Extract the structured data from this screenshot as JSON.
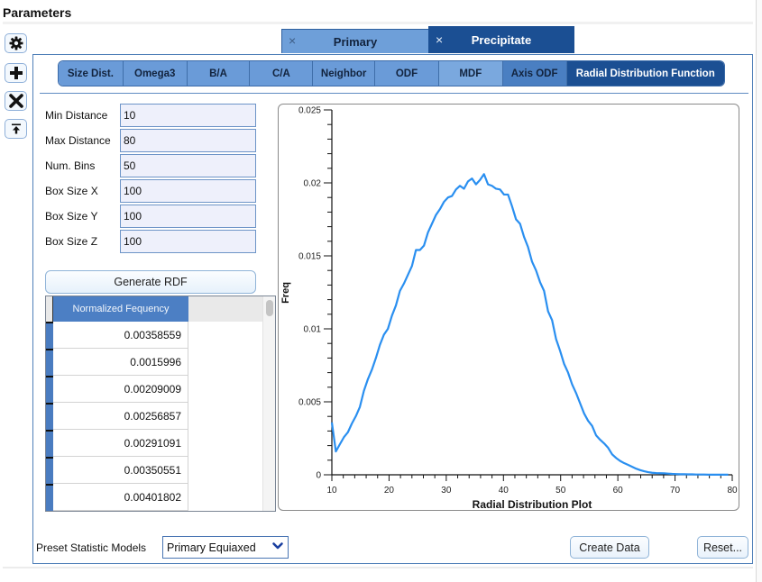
{
  "header": {
    "title": "Parameters"
  },
  "toolbar": {
    "buttons": [
      {
        "name": "settings",
        "icon": "gear-icon"
      },
      {
        "name": "add",
        "icon": "plus-icon"
      },
      {
        "name": "remove",
        "icon": "close-icon"
      },
      {
        "name": "move-to-top",
        "icon": "arrow-to-top-icon"
      }
    ]
  },
  "phase_tabs": [
    {
      "label": "Primary",
      "close": "×",
      "active": false
    },
    {
      "label": "Precipitate",
      "close": "×",
      "active": true
    }
  ],
  "sub_tabs": [
    {
      "label": "Size Dist.",
      "active": false
    },
    {
      "label": "Omega3",
      "active": false
    },
    {
      "label": "B/A",
      "active": false
    },
    {
      "label": "C/A",
      "active": false
    },
    {
      "label": "Neighbor",
      "active": false
    },
    {
      "label": "ODF",
      "active": false
    },
    {
      "label": "MDF",
      "active": false
    },
    {
      "label": "Axis ODF",
      "active": false
    },
    {
      "label": "Radial Distribution Function",
      "active": true
    }
  ],
  "form": {
    "fields": [
      {
        "label": "Min Distance",
        "value": "10"
      },
      {
        "label": "Max Distance",
        "value": "80"
      },
      {
        "label": "Num. Bins",
        "value": "50"
      },
      {
        "label": "Box Size X",
        "value": "100"
      },
      {
        "label": "Box Size Y",
        "value": "100"
      },
      {
        "label": "Box Size Z",
        "value": "100"
      }
    ],
    "generate_label": "Generate RDF"
  },
  "table": {
    "column_header": "Normalized Fequency",
    "rows": [
      "0.00358559",
      "0.0015996",
      "0.00209009",
      "0.00256857",
      "0.00291091",
      "0.00350551",
      "0.00401802"
    ]
  },
  "footer": {
    "preset_label": "Preset Statistic Models",
    "preset_value": "Primary Equiaxed",
    "create_label": "Create Data",
    "reset_label": "Reset..."
  },
  "colors": {
    "tab_active": "#1b4f93",
    "tab_inactive": "#6a9bd8",
    "series": "#2a8ff0"
  },
  "chart_data": {
    "type": "line",
    "title": "",
    "xlabel": "Radial Distribution Plot",
    "ylabel": "Freq",
    "xlim": [
      10,
      80
    ],
    "ylim": [
      0,
      0.025
    ],
    "x_ticks": [
      10,
      20,
      30,
      40,
      50,
      60,
      70,
      80
    ],
    "x_tick_labels": [
      "10",
      "20",
      "30",
      "40",
      "50",
      "60",
      "70",
      "80"
    ],
    "y_ticks": [
      0,
      0.005,
      0.01,
      0.015,
      0.02,
      0.025
    ],
    "y_tick_labels": [
      "0",
      "0.005",
      "0.01",
      "0.015",
      "0.02",
      "0.025"
    ],
    "grid": false,
    "legend": "none",
    "series": [
      {
        "name": "Freq",
        "x_start": 10,
        "x_step": 0.7,
        "values": [
          0.00359,
          0.0016,
          0.00209,
          0.00257,
          0.00291,
          0.00351,
          0.00402,
          0.00465,
          0.00575,
          0.00655,
          0.0072,
          0.008,
          0.0089,
          0.0096,
          0.01,
          0.0109,
          0.0116,
          0.0126,
          0.0131,
          0.0137,
          0.0143,
          0.0154,
          0.0154,
          0.0157,
          0.0166,
          0.0172,
          0.0178,
          0.0182,
          0.0187,
          0.019,
          0.0191,
          0.01955,
          0.0198,
          0.0196,
          0.0201,
          0.0203,
          0.0199,
          0.0202,
          0.0206,
          0.0199,
          0.0198,
          0.0196,
          0.01955,
          0.0192,
          0.0192,
          0.0184,
          0.0175,
          0.0172,
          0.0163,
          0.0156,
          0.0146,
          0.014,
          0.0132,
          0.0126,
          0.0112,
          0.0106,
          0.0093,
          0.0085,
          0.0076,
          0.007,
          0.0062,
          0.0056,
          0.0049,
          0.0042,
          0.0037,
          0.00335,
          0.0027,
          0.0024,
          0.00215,
          0.00185,
          0.0014,
          0.00115,
          0.00095,
          0.0008,
          0.00068,
          0.00055,
          0.00042,
          0.00032,
          0.00024,
          0.00018,
          0.00014,
          0.00012,
          0.00011,
          0.0001,
          8e-05,
          6e-05,
          5e-05,
          4e-05,
          4e-05,
          3e-05,
          3e-05,
          2e-05,
          2e-05,
          2e-05,
          1e-05,
          1e-05,
          1e-05,
          1e-05,
          1e-05,
          1e-05
        ]
      }
    ]
  }
}
